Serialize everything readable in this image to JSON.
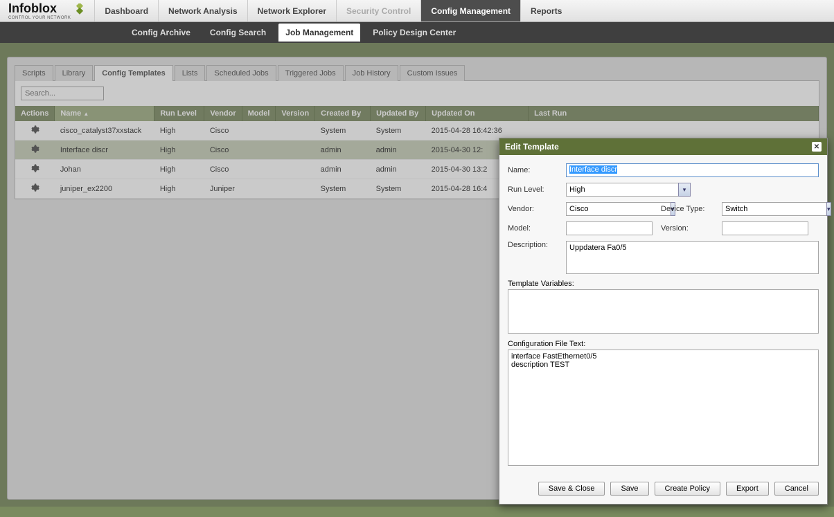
{
  "logo": {
    "text": "Infoblox",
    "sub": "CONTROL YOUR NETWORK"
  },
  "main_nav": {
    "dashboard": "Dashboard",
    "network_analysis": "Network Analysis",
    "network_explorer": "Network Explorer",
    "security_control": "Security Control",
    "config_management": "Config Management",
    "reports": "Reports"
  },
  "sub_nav": {
    "config_archive": "Config Archive",
    "config_search": "Config Search",
    "job_management": "Job Management",
    "policy_design_center": "Policy Design Center"
  },
  "inner_tabs": {
    "scripts": "Scripts",
    "library": "Library",
    "config_templates": "Config Templates",
    "lists": "Lists",
    "scheduled_jobs": "Scheduled Jobs",
    "triggered_jobs": "Triggered Jobs",
    "job_history": "Job History",
    "custom_issues": "Custom Issues"
  },
  "search": {
    "placeholder": "Search..."
  },
  "grid": {
    "headers": {
      "actions": "Actions",
      "name": "Name",
      "run_level": "Run Level",
      "vendor": "Vendor",
      "model": "Model",
      "version": "Version",
      "created_by": "Created By",
      "updated_by": "Updated By",
      "updated_on": "Updated On",
      "last_run": "Last Run"
    },
    "rows": [
      {
        "name": "cisco_catalyst37xxstack",
        "run_level": "High",
        "vendor": "Cisco",
        "model": "",
        "version": "",
        "created_by": "System",
        "updated_by": "System",
        "updated_on": "2015-04-28 16:42:36",
        "last_run": ""
      },
      {
        "name": "Interface discr",
        "run_level": "High",
        "vendor": "Cisco",
        "model": "",
        "version": "",
        "created_by": "admin",
        "updated_by": "admin",
        "updated_on": "2015-04-30 12:",
        "last_run": ""
      },
      {
        "name": "Johan",
        "run_level": "High",
        "vendor": "Cisco",
        "model": "",
        "version": "",
        "created_by": "admin",
        "updated_by": "admin",
        "updated_on": "2015-04-30 13:2",
        "last_run": ""
      },
      {
        "name": "juniper_ex2200",
        "run_level": "High",
        "vendor": "Juniper",
        "model": "",
        "version": "",
        "created_by": "System",
        "updated_by": "System",
        "updated_on": "2015-04-28 16:4",
        "last_run": ""
      }
    ]
  },
  "dialog": {
    "title": "Edit Template",
    "labels": {
      "name": "Name:",
      "run_level": "Run Level:",
      "vendor": "Vendor:",
      "device_type": "Device Type:",
      "model": "Model:",
      "version": "Version:",
      "description": "Description:",
      "template_variables": "Template Variables:",
      "config_file_text": "Configuration File Text:"
    },
    "values": {
      "name": "Interface discr",
      "run_level": "High",
      "vendor": "Cisco",
      "device_type": "Switch",
      "model": "",
      "version": "",
      "description": "Uppdatera Fa0/5",
      "template_variables": "",
      "config_file_text": "interface FastEthernet0/5\ndescription TEST"
    },
    "buttons": {
      "save_close": "Save & Close",
      "save": "Save",
      "create_policy": "Create Policy",
      "export": "Export",
      "cancel": "Cancel"
    }
  }
}
